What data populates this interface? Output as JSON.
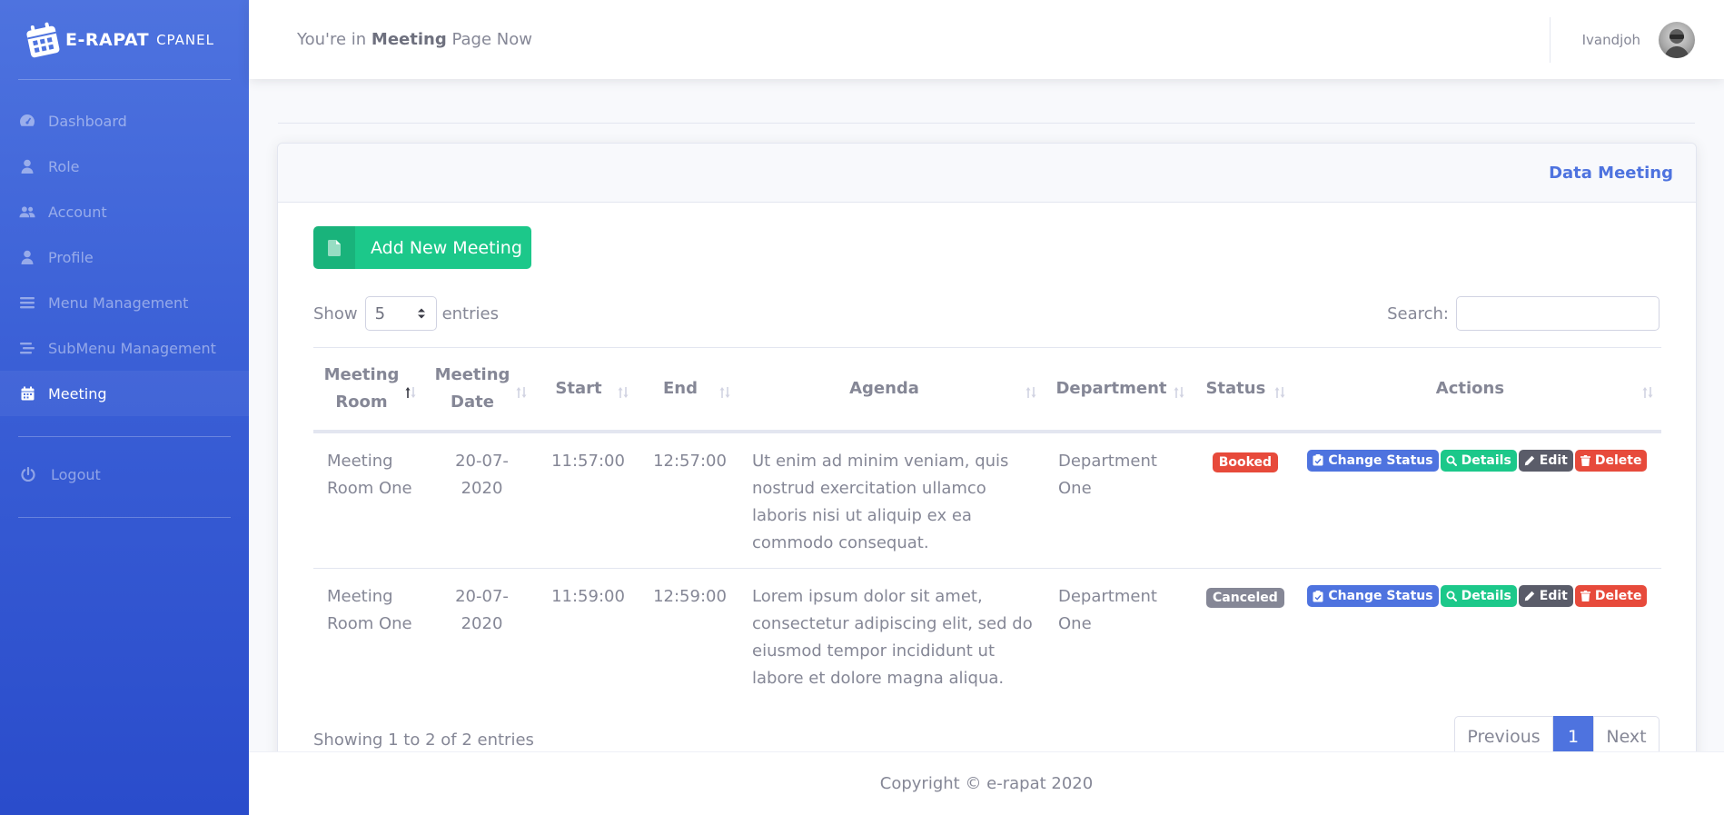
{
  "brand": {
    "name": "E-RAPAT",
    "suffix": "CPANEL"
  },
  "sidebar": {
    "items": [
      {
        "label": "Dashboard",
        "icon": "dashboard-icon"
      },
      {
        "label": "Role",
        "icon": "user-icon"
      },
      {
        "label": "Account",
        "icon": "users-icon"
      },
      {
        "label": "Profile",
        "icon": "user-icon"
      },
      {
        "label": "Menu Management",
        "icon": "bars-icon"
      },
      {
        "label": "SubMenu Management",
        "icon": "stream-icon"
      },
      {
        "label": "Meeting",
        "icon": "calendar-icon",
        "active": true
      }
    ],
    "logout": "Logout"
  },
  "topbar": {
    "prefix": "You're in",
    "page": "Meeting",
    "suffix": "Page Now",
    "username": "Ivandjoh"
  },
  "card": {
    "title": "Data Meeting"
  },
  "add_button": "Add New Meeting",
  "table_controls": {
    "show_label": "Show",
    "entries_value": "5",
    "entries_label": "entries",
    "search_label": "Search:",
    "search_value": ""
  },
  "table": {
    "columns": [
      "Meeting Room",
      "Meeting Date",
      "Start",
      "End",
      "Agenda",
      "Department",
      "Status",
      "Actions"
    ],
    "rows": [
      {
        "room": "Meeting Room One",
        "date": "20-07-2020",
        "start": "11:57:00",
        "end": "12:57:00",
        "agenda": "Ut enim ad minim veniam, quis nostrud exercitation ullamco laboris nisi ut aliquip ex ea commodo consequat.",
        "department": "Department One",
        "status": "Booked"
      },
      {
        "room": "Meeting Room One",
        "date": "20-07-2020",
        "start": "11:59:00",
        "end": "12:59:00",
        "agenda": "Lorem ipsum dolor sit amet, consectetur adipiscing elit, sed do eiusmod tempor incididunt ut labore et dolore magna aliqua.",
        "department": "Department One",
        "status": "Canceled"
      }
    ],
    "actions": {
      "change_status": "Change Status",
      "details": "Details",
      "edit": "Edit",
      "delete": "Delete"
    }
  },
  "pagination": {
    "info": "Showing 1 to 2 of 2 entries",
    "previous": "Previous",
    "current": "1",
    "next": "Next"
  },
  "footer": {
    "copyright": "Copyright © e-rapat 2020"
  },
  "colors": {
    "primary": "#4e73df",
    "success": "#1cc88a",
    "danger": "#e74a3b",
    "secondary": "#858796",
    "dark": "#5a5c69"
  }
}
